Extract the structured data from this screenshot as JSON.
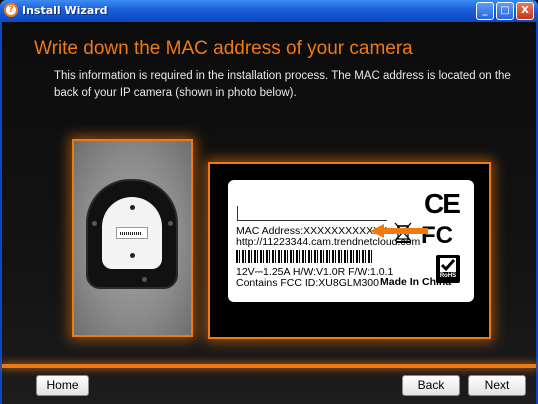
{
  "window": {
    "title": "Install Wizard",
    "minimize_glyph": "_",
    "maximize_glyph": "□",
    "close_glyph": "X"
  },
  "page": {
    "heading": "Write down the MAC address of your camera",
    "description": "This information is required in the installation process. The MAC address is located on the back of your IP camera (shown in photo below)."
  },
  "label": {
    "mac": "MAC Address:XXXXXXXXXXXX",
    "url": "http://11223344.cam.trendnetcloud.com",
    "power": "12V⎓1.25A H/W:V1.0R  F/W:1.0.1",
    "fcc": "Contains FCC ID:XU8GLM300",
    "made_in": "Made In China",
    "ce": "CE",
    "fc": "FC",
    "rohs": "RoHS"
  },
  "footer": {
    "home_label": "Home",
    "back_label": "Back",
    "next_label": "Next"
  },
  "colors": {
    "accent": "#f07a12",
    "titlebar": "#1a5ed8",
    "background": "#111111"
  },
  "icons": {
    "app": "wizard-icon",
    "arrow": "arrow-left-icon",
    "bin": "crossed-bin-icon",
    "rohs": "rohs-check-icon"
  }
}
